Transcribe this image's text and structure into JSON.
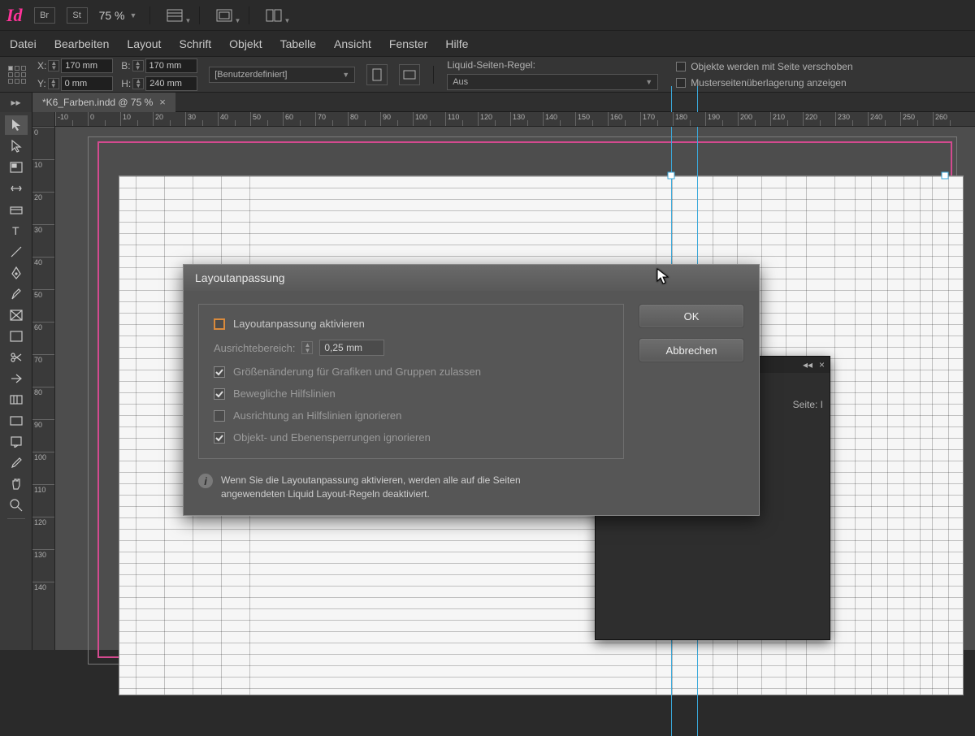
{
  "app": {
    "logo_text": "Id",
    "br_badge": "Br",
    "st_badge": "St",
    "zoom": "75 %"
  },
  "menu": [
    "Datei",
    "Bearbeiten",
    "Layout",
    "Schrift",
    "Objekt",
    "Tabelle",
    "Ansicht",
    "Fenster",
    "Hilfe"
  ],
  "ctrl": {
    "x_label": "X:",
    "y_label": "Y:",
    "b_label": "B:",
    "h_label": "H:",
    "x_value": "170 mm",
    "y_value": "0 mm",
    "b_value": "170 mm",
    "h_value": "240 mm",
    "preset": "[Benutzerdefiniert]",
    "liquid_title": "Liquid-Seiten-Regel:",
    "liquid_value": "Aus",
    "chk_move": "Objekte werden mit Seite verschoben",
    "chk_master": "Musterseitenüberlagerung anzeigen"
  },
  "tab": {
    "label": "*K6_Farben.indd @ 75 %"
  },
  "rulerH": [
    -10,
    0,
    10,
    20,
    30,
    40,
    50,
    60,
    70,
    80,
    90,
    100,
    110,
    120,
    130,
    140,
    150,
    160,
    170,
    180,
    190,
    200,
    210,
    220,
    230,
    240,
    250,
    260
  ],
  "rulerV": [
    0,
    10,
    20,
    30,
    40,
    50,
    60,
    70,
    80,
    90,
    100,
    110,
    120,
    130,
    140
  ],
  "panel": {
    "seite_label": "Seite: I"
  },
  "dialog": {
    "title": "Layoutanpassung",
    "activate_label": "Layoutanpassung aktivieren",
    "snap_label": "Ausrichtebereich:",
    "snap_value": "0,25 mm",
    "opt_resize": "Größenänderung für Grafiken und Gruppen zulassen",
    "opt_guides": "Bewegliche Hilfslinien",
    "opt_ignore_guides": "Ausrichtung an Hilfslinien ignorieren",
    "opt_ignore_locks": "Objekt- und Ebenensperrungen ignorieren",
    "info": "Wenn Sie die Layoutanpassung aktivieren, werden alle auf die Seiten angewendeten Liquid Layout-Regeln deaktiviert.",
    "ok": "OK",
    "cancel": "Abbrechen"
  },
  "colors": {
    "accent": "#ff3399",
    "orange": "#d98a3c",
    "guide": "#3aa9db",
    "frame": "#d34a8f"
  }
}
